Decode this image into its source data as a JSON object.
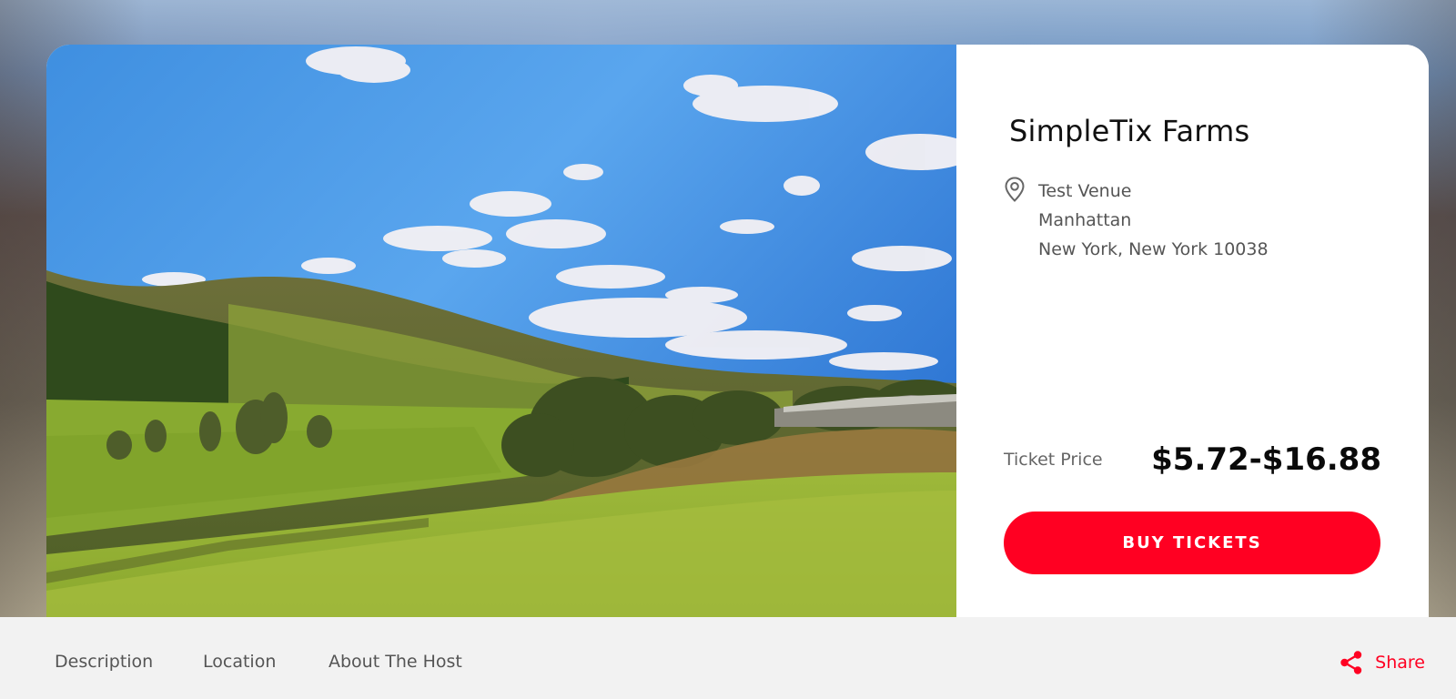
{
  "event": {
    "title": "SimpleTix Farms",
    "venue": {
      "name": "Test Venue",
      "area": "Manhattan",
      "city_state_zip": "New York, New York 10038"
    },
    "ticket_price_label": "Ticket Price",
    "ticket_price": "$5.72-$16.88",
    "buy_button": "BUY TICKETS"
  },
  "tabs": [
    "Description",
    "Location",
    "About The Host"
  ],
  "share_label": "Share",
  "icons": {
    "venue": "location-pin-icon",
    "share": "share-icon"
  },
  "colors": {
    "accent": "#ff0022",
    "text": "#111111",
    "muted": "#555555",
    "tabbar_bg": "#f2f2f2"
  }
}
